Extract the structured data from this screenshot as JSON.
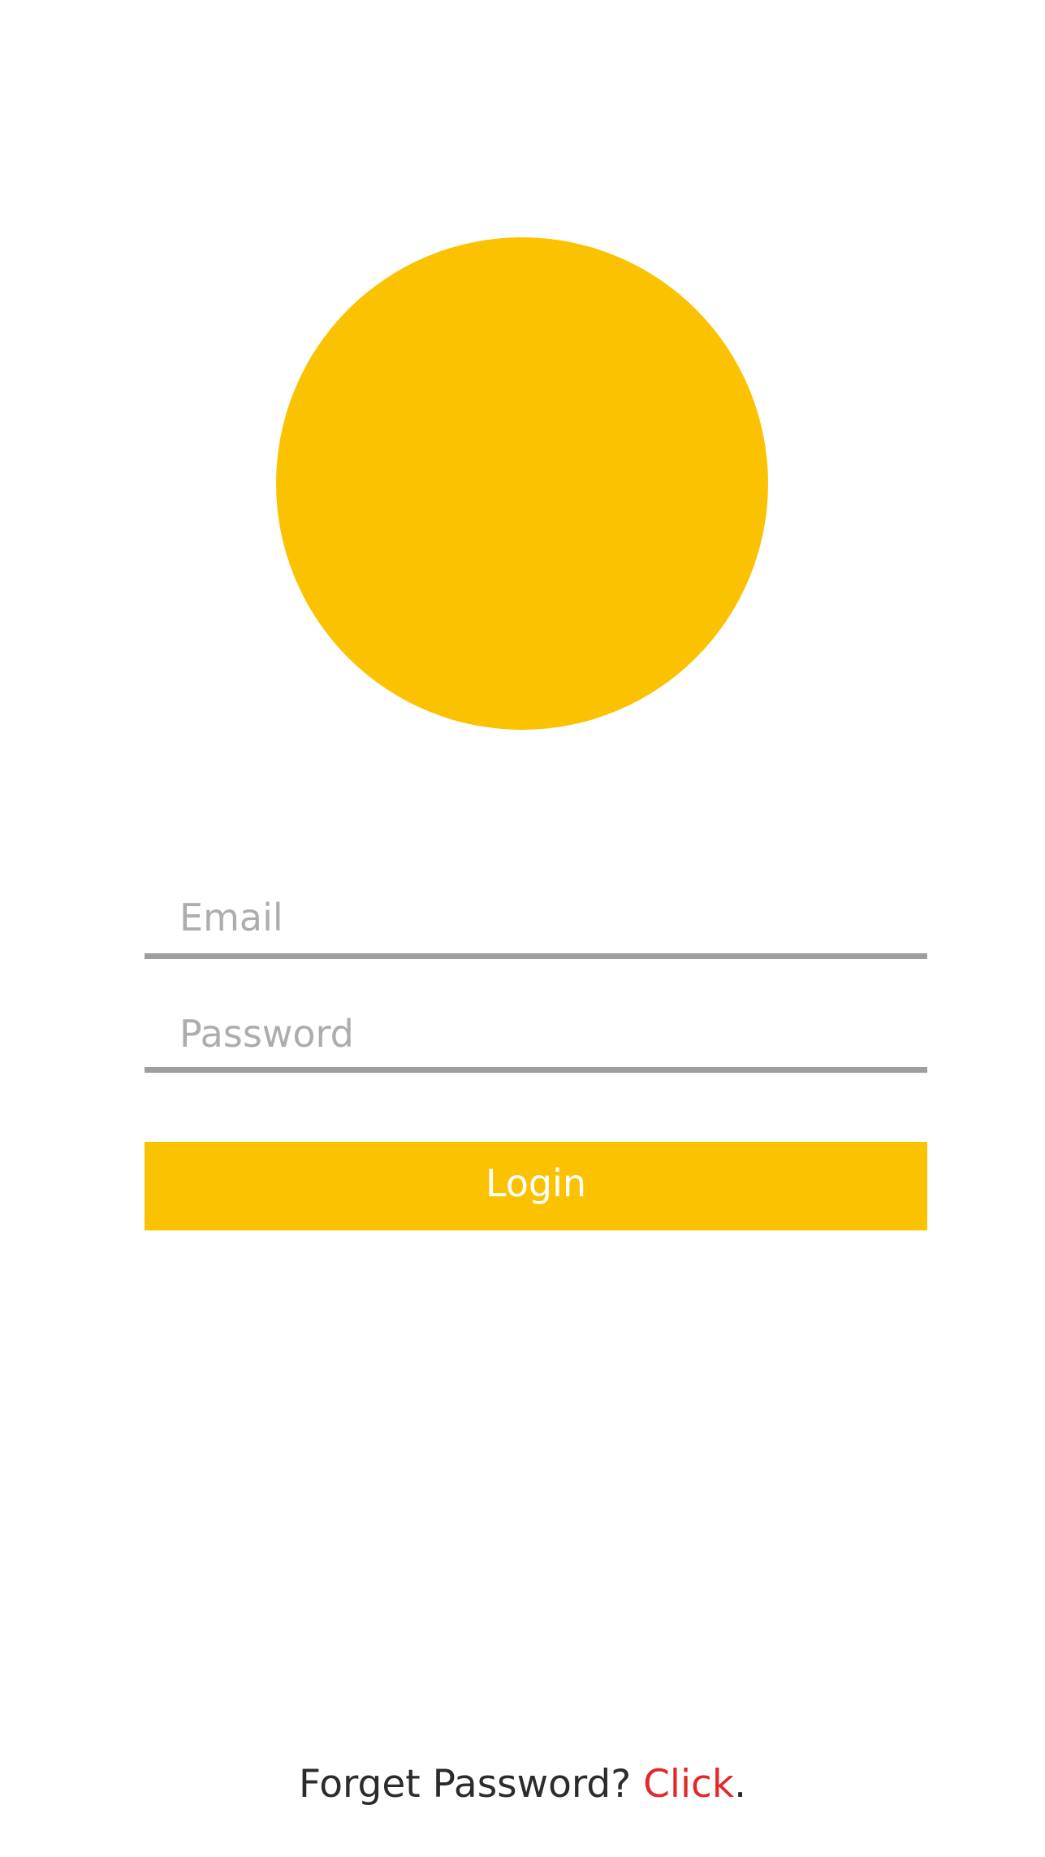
{
  "colors": {
    "accent": "#FBC202",
    "link": "#E02A2A",
    "underline": "#9E9E9E"
  },
  "form": {
    "email_placeholder": "Email",
    "password_placeholder": "Password",
    "login_label": "Login"
  },
  "footer": {
    "prompt": "Forget Password? ",
    "link_text": "Click",
    "suffix": "."
  }
}
